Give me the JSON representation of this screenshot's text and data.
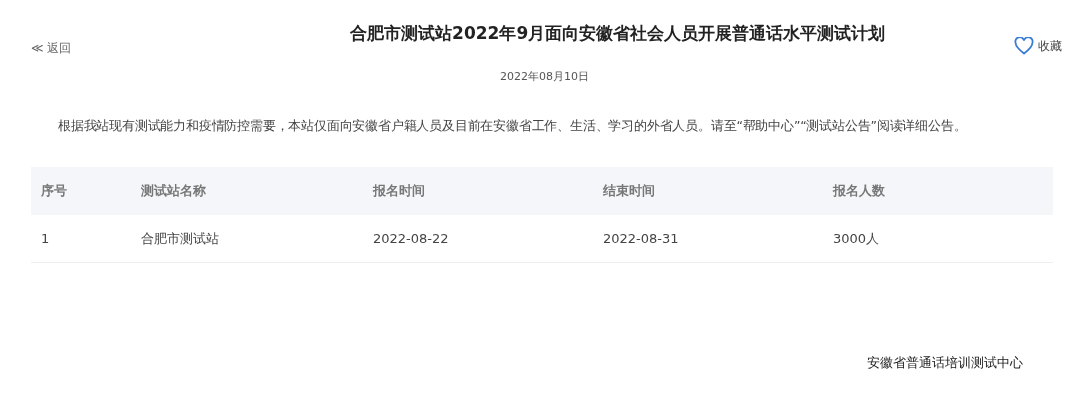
{
  "back_link": {
    "icon": "≪",
    "label": "返回"
  },
  "title": "合肥市测试站2022年9月面向安徽省社会人员开展普通话水平测试计划",
  "favorite": {
    "label": "收藏",
    "selected": false
  },
  "date": "2022年08月10日",
  "notice": "根据我站现有测试能力和疫情防控需要，本站仅面向安徽省户籍人员及目前在安徽省工作、生活、学习的外省人员。请至“帮助中心”“测试站公告”阅读详细公告。",
  "table": {
    "columns": [
      "序号",
      "测试站名称",
      "报名时间",
      "结束时间",
      "报名人数"
    ],
    "rows": [
      [
        "1",
        "合肥市测试站",
        "2022-08-22",
        "2022-08-31",
        "3000人"
      ]
    ]
  },
  "footer": "安徽省普通话培训测试中心"
}
